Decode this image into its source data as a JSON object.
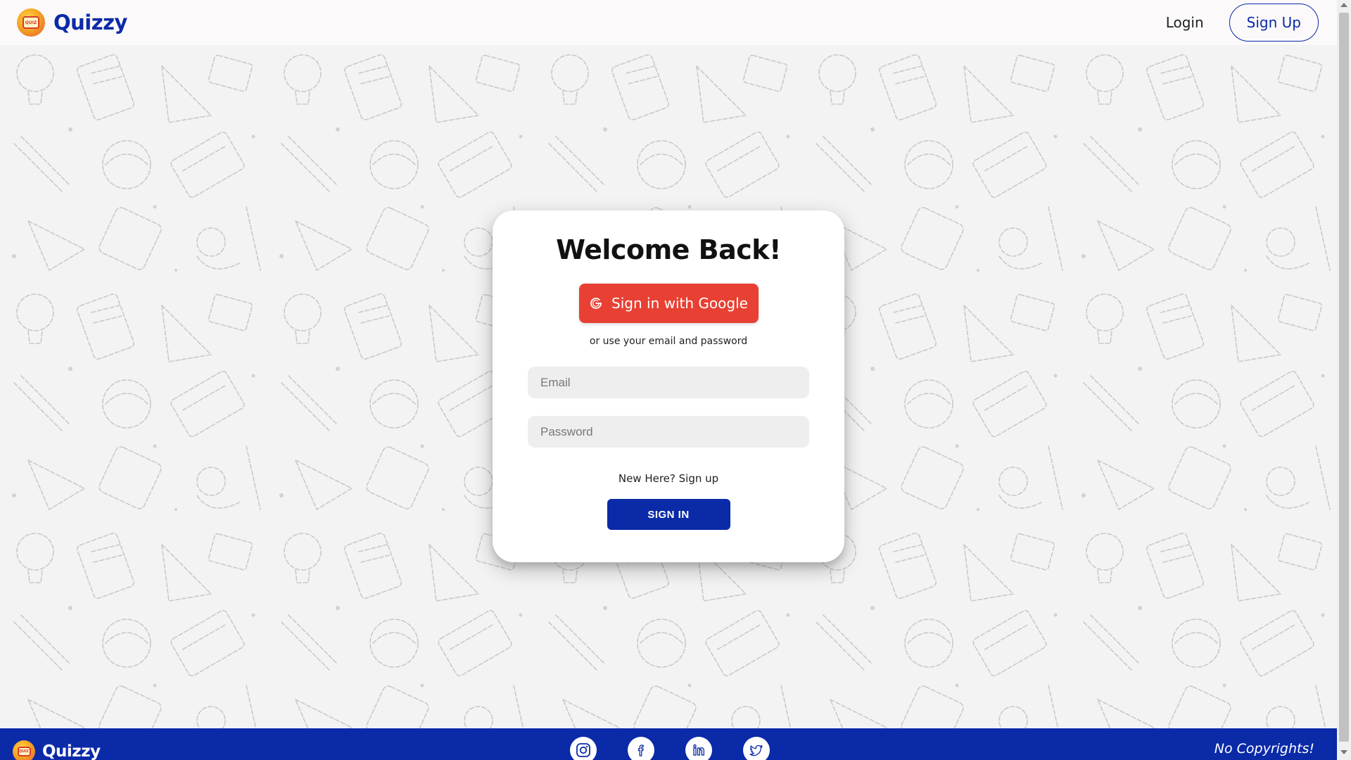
{
  "header": {
    "brand": "Quizzy",
    "logo_text": "QUIZ",
    "login_label": "Login",
    "signup_label": "Sign Up"
  },
  "card": {
    "title": "Welcome Back!",
    "google_label": "Sign in with Google",
    "or_text": "or use your email and password",
    "email_placeholder": "Email",
    "email_value": "",
    "password_placeholder": "Password",
    "password_value": "",
    "signup_prompt": "New Here? Sign up",
    "signin_label": "SIGN IN"
  },
  "footer": {
    "brand": "Quizzy",
    "logo_text": "QUIZ",
    "copyright": "No Copyrights!",
    "socials": [
      "instagram-icon",
      "facebook-icon",
      "linkedin-icon",
      "twitter-icon"
    ]
  },
  "colors": {
    "brand_blue": "#0a2aa8",
    "google_red": "#e84033",
    "card_bg": "#ffffff",
    "page_bg": "#f3f3f4"
  }
}
